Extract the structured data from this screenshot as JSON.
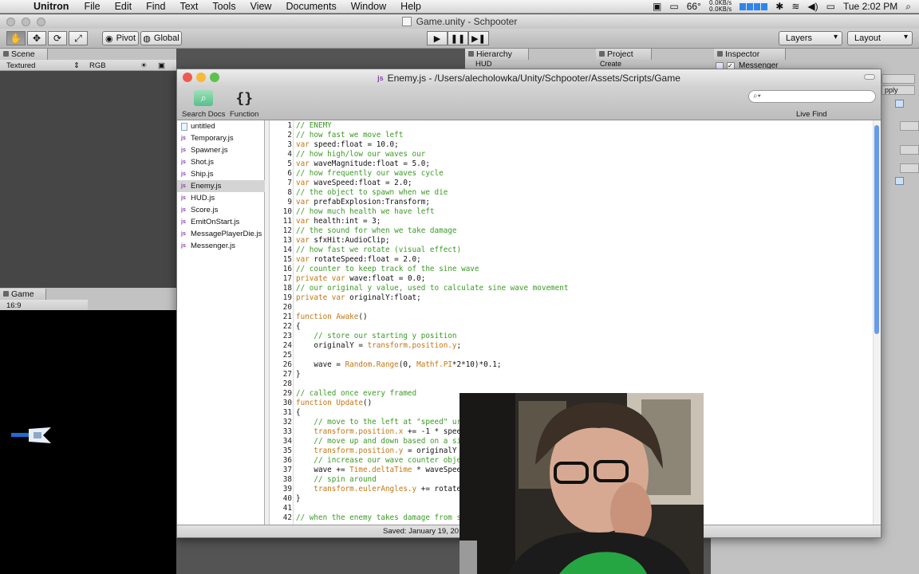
{
  "menubar": {
    "app": "Unitron",
    "items": [
      "File",
      "Edit",
      "Find",
      "Text",
      "Tools",
      "View",
      "Documents",
      "Window",
      "Help"
    ],
    "temperature": "66°",
    "net_up": "0.0KB/s",
    "net_down": "0.0KB/s",
    "clock": "Tue 2:02 PM"
  },
  "unity": {
    "title": "Game.unity - Schpooter",
    "pivot": "Pivot",
    "global": "Global",
    "layers": "Layers",
    "layout": "Layout",
    "scene_tab": "Scene",
    "scene_shading": "Textured",
    "scene_mode": "RGB",
    "game_tab": "Game",
    "aspect": "16:9",
    "hierarchy_tab": "Hierarchy",
    "hierarchy_item": "HUD",
    "project_tab": "Project",
    "project_create": "Create",
    "inspector_tab": "Inspector",
    "inspector_object": "Messenger",
    "inspector_apply": "pply"
  },
  "editor": {
    "title_path": "Enemy.js - /Users/alecholowka/Unity/Schpooter/Assets/Scripts/Game",
    "search_docs_label": "Search Docs",
    "function_label": "Function",
    "live_find_label": "Live Find",
    "files": [
      "untitled",
      "Temporary.js",
      "Spawner.js",
      "Shot.js",
      "Ship.js",
      "Enemy.js",
      "HUD.js",
      "Score.js",
      "EmitOnStart.js",
      "MessagePlayerDie.js",
      "Messenger.js"
    ],
    "selected_file": "Enemy.js",
    "status": "Saved: January 19, 201",
    "lines": [
      "// ENEMY",
      "// how fast we move left",
      "var speed:float = 10.0;",
      "// how high/low our waves our",
      "var waveMagnitude:float = 5.0;",
      "// how frequently our waves cycle",
      "var waveSpeed:float = 2.0;",
      "// the object to spawn when we die",
      "var prefabExplosion:Transform;",
      "// how much health we have left",
      "var health:int = 3;",
      "// the sound for when we take damage",
      "var sfxHit:AudioClip;",
      "// how fast we rotate (visual effect)",
      "var rotateSpeed:float = 2.0;",
      "// counter to keep track of the sine wave",
      "private var wave:float = 0.0;",
      "// our original y value, used to calculate sine wave movement",
      "private var originalY:float;",
      "",
      "function Awake()",
      "{",
      "    // store our starting y position",
      "    originalY = transform.position.y;",
      "",
      "    wave = Random.Range(0, Mathf.PI*2*10)*0.1;",
      "}",
      "",
      "// called once every framed",
      "function Update()",
      "{",
      "    // move to the left at \"speed\" ur",
      "    transform.position.x += -1 * spee",
      "    // move up and down based on a si",
      "    transform.position.y = originalY",
      "    // increase our wave counter obje",
      "    wave += Time.deltaTime * waveSpee",
      "    // spin around",
      "    transform.eulerAngles.y += rotate",
      "}",
      "",
      "// when the enemy takes damage from s"
    ]
  }
}
